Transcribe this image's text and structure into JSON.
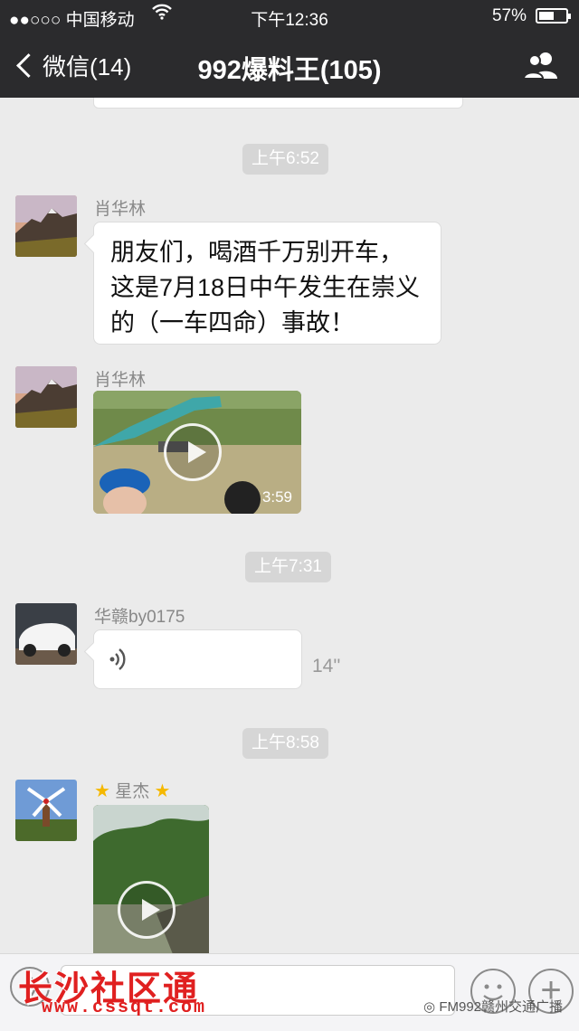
{
  "status_bar": {
    "signal": "●●○○○",
    "carrier": "中国移动",
    "time": "下午12:36",
    "battery_percent": "57%",
    "battery_level": 0.57
  },
  "nav": {
    "back_label": "微信(14)",
    "title": "992爆料王(105)"
  },
  "messages": [
    {
      "type": "timestamp",
      "text": "上午6:52"
    },
    {
      "type": "text",
      "sender": "肖华林",
      "lines": [
        "朋友们，喝酒千万别开车，",
        "这是7月18日中午发生在崇义",
        "的（一车四命）事故！"
      ]
    },
    {
      "type": "video",
      "sender": "肖华林",
      "duration": "3:59"
    },
    {
      "type": "timestamp",
      "text": "上午7:31"
    },
    {
      "type": "voice",
      "sender": "华赣by0175",
      "length": "14''"
    },
    {
      "type": "timestamp",
      "text": "上午8:58"
    },
    {
      "type": "video",
      "sender": "星杰",
      "sender_decoration": "star-emoji"
    }
  ],
  "watermarks": {
    "site_name": "长沙社区通",
    "site_url": "www.cssqt.com",
    "source": "FM992赣州交通广播"
  },
  "colors": {
    "header_bg": "#2b2b2d",
    "chat_bg": "#ebebeb",
    "timestamp_bg": "#d6d6d6",
    "watermark_red": "#e02020"
  }
}
